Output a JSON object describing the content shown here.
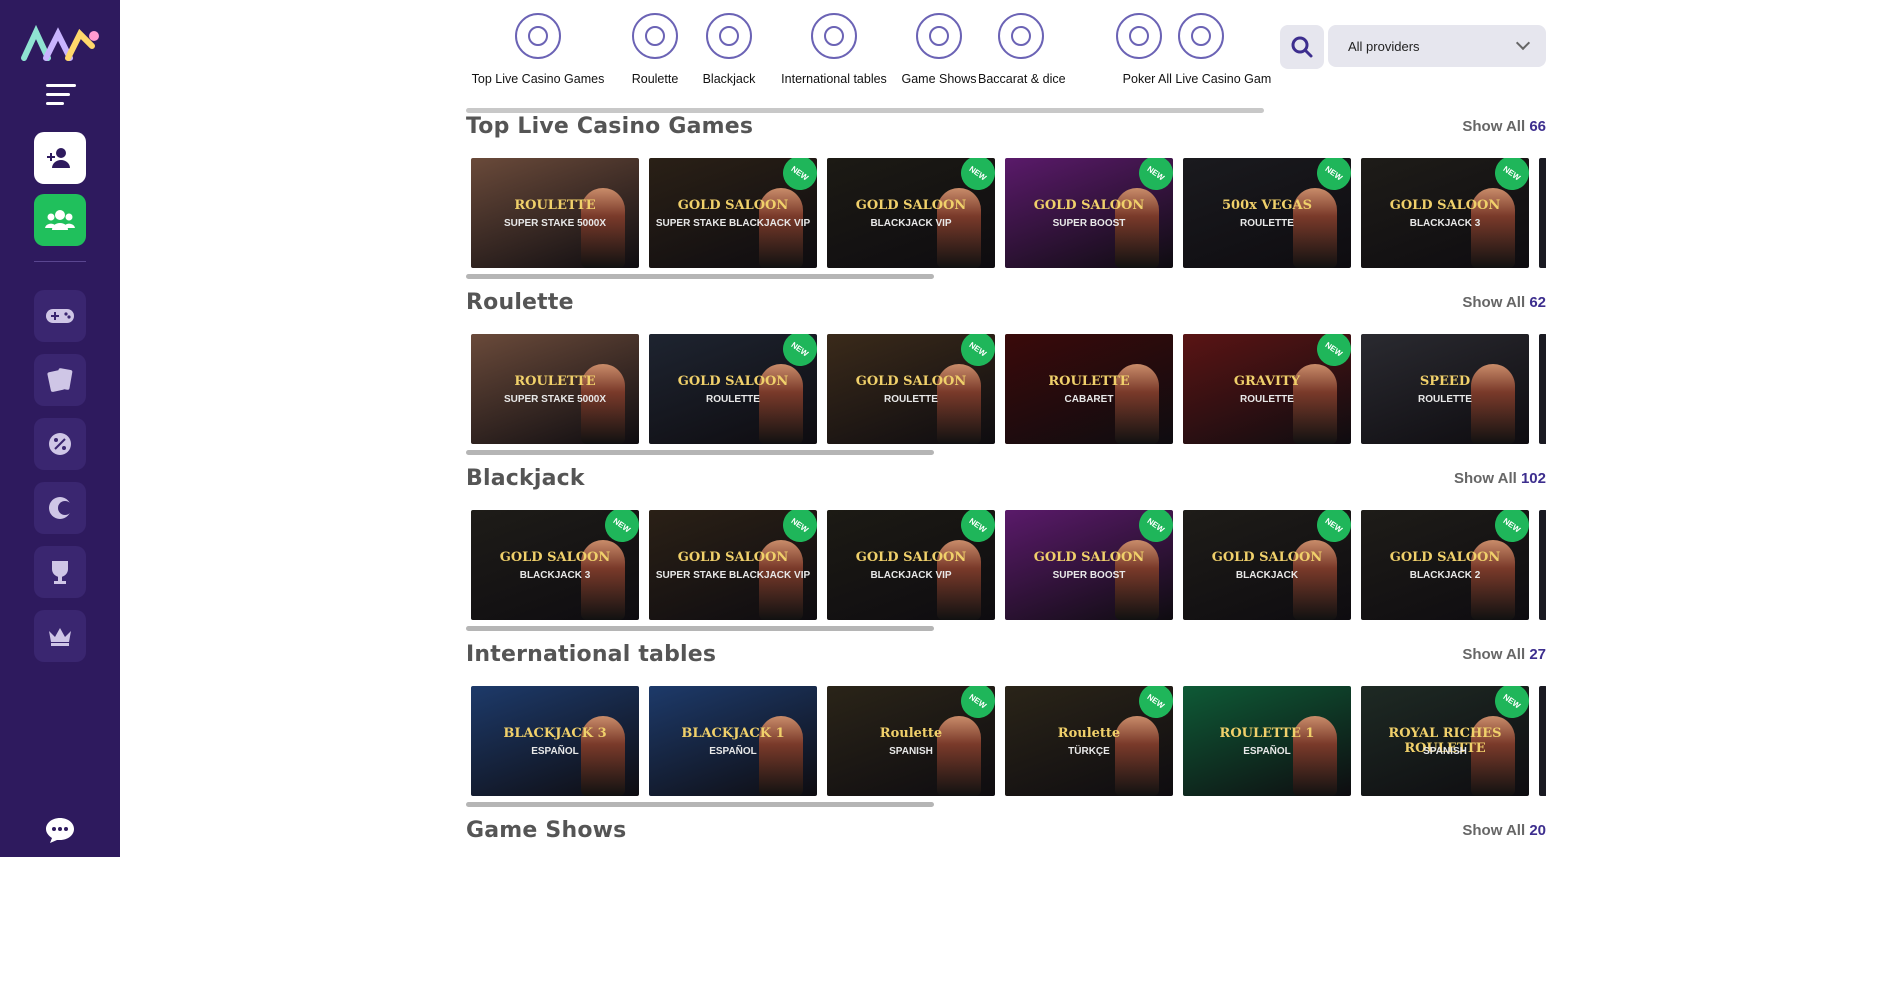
{
  "brand": {
    "accent": "#2e1a5e",
    "green": "#20c05c",
    "count_color": "#3d2e8e"
  },
  "categories": [
    {
      "label": "Top Live Casino Games",
      "icon": "diamond-icon"
    },
    {
      "label": "Roulette",
      "icon": "roulette-wheel-icon"
    },
    {
      "label": "Blackjack",
      "icon": "playing-cards-icon"
    },
    {
      "label": "International tables",
      "icon": "international-dealer-icon"
    },
    {
      "label": "Game Shows",
      "icon": "game-show-host-icon"
    },
    {
      "label": "Baccarat & dice",
      "icon": "cards-and-dice-icon"
    },
    {
      "label": "Poker",
      "icon": "poker-chip-icon"
    },
    {
      "label": "All Live Casino Gam",
      "icon": "all-games-icon"
    }
  ],
  "providers": {
    "selected": "All providers"
  },
  "show_all_label": "Show All",
  "new_badge": "NEW",
  "sections": [
    {
      "title": "Top Live Casino Games",
      "count": "66",
      "tiles": [
        {
          "t1": "ROULETTE",
          "t2": "SUPER STAKE 5000X",
          "bg": "#6a4a3a",
          "new": false
        },
        {
          "t1": "GOLD SALOON",
          "t2": "SUPER STAKE BLACKJACK VIP",
          "bg": "#2a2016",
          "new": true
        },
        {
          "t1": "GOLD SALOON",
          "t2": "BLACKJACK VIP",
          "bg": "#1c1a14",
          "new": true
        },
        {
          "t1": "GOLD SALOON",
          "t2": "SUPER BOOST",
          "bg": "#5a1a6a",
          "new": true
        },
        {
          "t1": "500x VEGAS",
          "t2": "ROULETTE",
          "bg": "#1a1a1e",
          "new": true
        },
        {
          "t1": "GOLD SALOON",
          "t2": "BLACKJACK 3",
          "bg": "#1e1c18",
          "new": true
        }
      ]
    },
    {
      "title": "Roulette",
      "count": "62",
      "tiles": [
        {
          "t1": "ROULETTE",
          "t2": "SUPER STAKE 5000X",
          "bg": "#6a4a3a",
          "new": false
        },
        {
          "t1": "GOLD SALOON",
          "t2": "ROULETTE",
          "bg": "#1e2430",
          "new": true
        },
        {
          "t1": "GOLD SALOON",
          "t2": "ROULETTE",
          "bg": "#3a2a1a",
          "new": true
        },
        {
          "t1": "ROULETTE",
          "t2": "CABARET",
          "bg": "#3a0a0a",
          "new": false
        },
        {
          "t1": "GRAVITY",
          "t2": "ROULETTE",
          "bg": "#5a1414",
          "new": true
        },
        {
          "t1": "SPEED",
          "t2": "ROULETTE",
          "bg": "#2a2a30",
          "new": false
        }
      ]
    },
    {
      "title": "Blackjack",
      "count": "102",
      "tiles": [
        {
          "t1": "GOLD SALOON",
          "t2": "BLACKJACK 3",
          "bg": "#1e1c18",
          "new": true
        },
        {
          "t1": "GOLD SALOON",
          "t2": "SUPER STAKE BLACKJACK VIP",
          "bg": "#2a2016",
          "new": true
        },
        {
          "t1": "GOLD SALOON",
          "t2": "BLACKJACK VIP",
          "bg": "#1c1a14",
          "new": true
        },
        {
          "t1": "GOLD SALOON",
          "t2": "SUPER BOOST",
          "bg": "#5a1a6a",
          "new": true
        },
        {
          "t1": "GOLD SALOON",
          "t2": "BLACKJACK",
          "bg": "#1e1c18",
          "new": true
        },
        {
          "t1": "GOLD SALOON",
          "t2": "BLACKJACK 2",
          "bg": "#1e1c18",
          "new": true
        }
      ]
    },
    {
      "title": "International tables",
      "count": "27",
      "tiles": [
        {
          "t1": "BLACKJACK 3",
          "t2": "ESPAÑOL",
          "bg": "#1d3a6a",
          "new": false
        },
        {
          "t1": "BLACKJACK 1",
          "t2": "ESPAÑOL",
          "bg": "#1d3a6a",
          "new": false
        },
        {
          "t1": "Roulette",
          "t2": "SPANISH",
          "bg": "#2a2418",
          "new": true
        },
        {
          "t1": "Roulette",
          "t2": "TÜRKÇE",
          "bg": "#2a2418",
          "new": true
        },
        {
          "t1": "ROULETTE 1",
          "t2": "ESPAÑOL",
          "bg": "#0e5a36",
          "new": false
        },
        {
          "t1": "ROYAL RICHES ROULETTE",
          "t2": "SPANISH",
          "bg": "#1e2a24",
          "new": true
        }
      ]
    },
    {
      "title": "Game Shows",
      "count": "20",
      "tiles": []
    }
  ]
}
